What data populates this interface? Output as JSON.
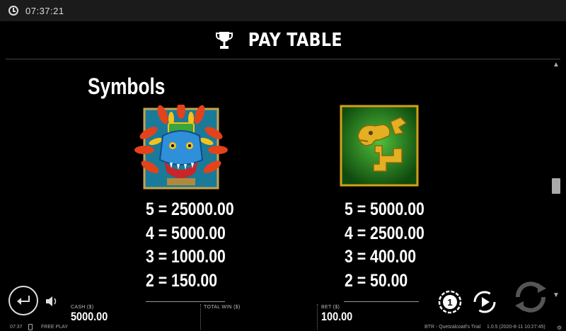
{
  "status": {
    "time": "07:37:21",
    "icon": "clock-icon"
  },
  "header": {
    "title": "PAY TABLE",
    "icon": "trophy-icon"
  },
  "section": {
    "title": "Symbols"
  },
  "symbols": [
    {
      "name": "quetzalcoatl-mask",
      "pays": [
        "5 = 25000.00",
        "4 = 5000.00",
        "3 = 1000.00",
        "2 = 150.00"
      ]
    },
    {
      "name": "golden-serpent",
      "pays": [
        "5 = 5000.00",
        "4 = 2500.00",
        "3 = 400.00",
        "2 = 50.00"
      ]
    }
  ],
  "bottom": {
    "cash_label": "CASH ($)",
    "cash_value": "5000.00",
    "totalwin_label": "TOTAL WIN ($)",
    "bet_label": "BET ($)",
    "bet_value": "100.00"
  },
  "footer": {
    "time": "07:37",
    "mode": "FREE PLAY",
    "game": "BTR - Quetzalcoatl's Trial",
    "version": "1.0.5 (2020-8-11 10:27:45)"
  },
  "colors": {
    "background": "#000000",
    "text": "#ffffff",
    "accent_gold": "#d4a018",
    "green_tile": "#1f6b1c"
  }
}
